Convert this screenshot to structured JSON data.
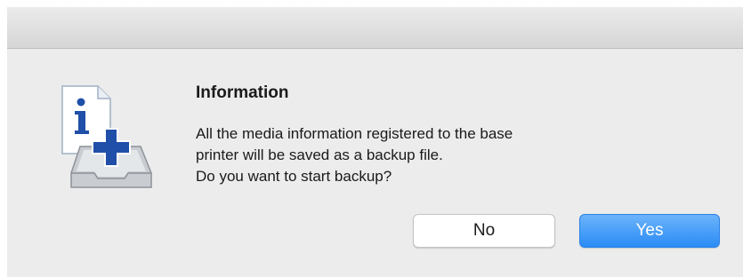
{
  "dialog": {
    "title": "Information",
    "message_lines": [
      "All the media information registered to the base",
      "printer will be saved as a backup file.",
      "Do you want to start backup?"
    ],
    "icon": "info-backup-tray-icon"
  },
  "buttons": {
    "no_label": "No",
    "yes_label": "Yes"
  },
  "colors": {
    "accent": "#2a8cf6",
    "icon_blue": "#1f4fa8",
    "dialog_bg": "#ececec"
  }
}
